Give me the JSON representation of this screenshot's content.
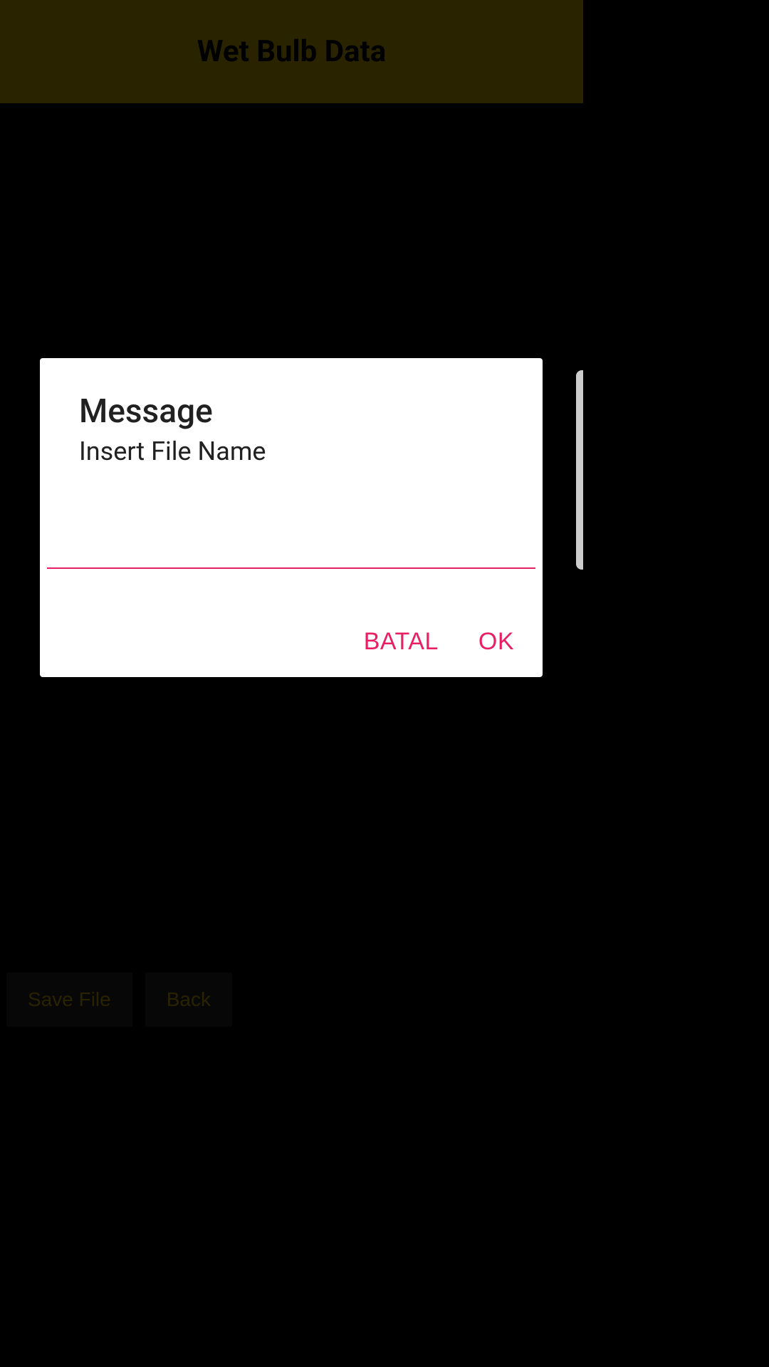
{
  "header": {
    "title": "Wet Bulb Data"
  },
  "dialog": {
    "title": "Message",
    "subtitle": "Insert File Name",
    "input_value": "",
    "cancel_label": "BATAL",
    "ok_label": "OK"
  },
  "bottom_bar": {
    "save_label": "Save File",
    "back_label": "Back"
  },
  "colors": {
    "accent": "#e91e63",
    "header_bg": "#b89b00",
    "background": "#000000",
    "dialog_bg": "#ffffff"
  }
}
